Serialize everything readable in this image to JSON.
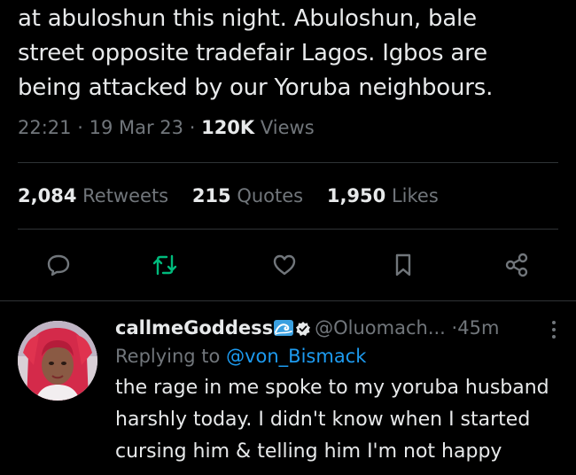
{
  "tweet": {
    "body_lines": [
      "at abuloshun this night. Abuloshun, bale",
      "street opposite tradefair Lagos. Igbos are",
      "being attacked by our Yoruba neighbours."
    ],
    "time": "22:21",
    "date": "19 Mar 23",
    "separator": "·",
    "views_count": "120K",
    "views_label": "Views",
    "stats": {
      "retweets_count": "2,084",
      "retweets_label": "Retweets",
      "quotes_count": "215",
      "quotes_label": "Quotes",
      "likes_count": "1,950",
      "likes_label": "Likes"
    },
    "actions": {
      "reply_icon": "speech-bubble-icon",
      "retweet_icon": "retweet-icon",
      "like_icon": "heart-icon",
      "bookmark_icon": "bookmark-icon",
      "share_icon": "share-icon"
    }
  },
  "reply": {
    "display_name": "callmeGoddess",
    "handle": "@Oluomach...",
    "separator": "·",
    "age": "45m",
    "replying_prefix": "Replying to",
    "replying_handle": "@von_Bismack",
    "text_lines": [
      "the rage in me spoke to my yoruba husband",
      "harshly today. I didn't know when I started",
      "cursing him & telling him I'm not happy"
    ]
  },
  "colors": {
    "background": "#000000",
    "primary_text": "#e7e9ea",
    "secondary_text": "#71767b",
    "divider": "#2f3336",
    "retweet_accent": "#00ba7c",
    "link": "#1d9bf0"
  }
}
